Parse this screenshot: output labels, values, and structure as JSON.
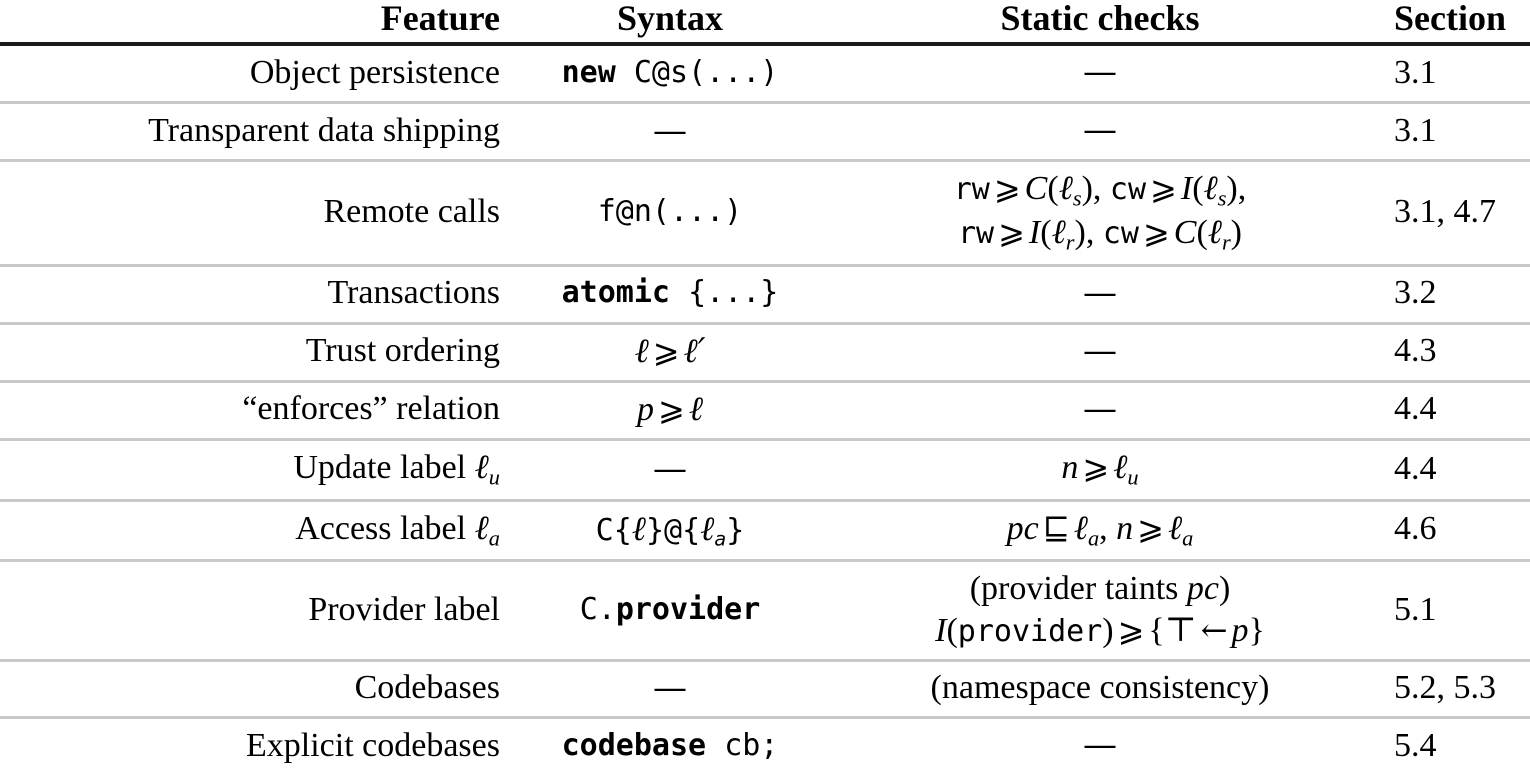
{
  "table": {
    "headers": {
      "feature": "Feature",
      "syntax": "Syntax",
      "checks": "Static checks",
      "section": "Section"
    },
    "rows": [
      {
        "feature": "Object persistence",
        "syntax": "new C@s(...)",
        "checks": "—",
        "section": "3.1"
      },
      {
        "feature": "Transparent data shipping",
        "syntax": "—",
        "checks": "—",
        "section": "3.1"
      },
      {
        "feature": "Remote calls",
        "syntax": "f@n(...)",
        "checks": "rw ⩾ C(ℓs), cw ⩾ I(ℓs), rw ⩾ I(ℓr), cw ⩾ C(ℓr)",
        "checks_line1": "rw ⩾ C(ℓs), cw ⩾ I(ℓs),",
        "checks_line2": "rw ⩾ I(ℓr), cw ⩾ C(ℓr)",
        "section": "3.1, 4.7"
      },
      {
        "feature": "Transactions",
        "syntax": "atomic {...}",
        "checks": "—",
        "section": "3.2"
      },
      {
        "feature": "Trust ordering",
        "syntax": "ℓ ⩾ ℓ′",
        "checks": "—",
        "section": "4.3"
      },
      {
        "feature": "“enforces” relation",
        "syntax": "p ⩾ ℓ",
        "checks": "—",
        "section": "4.4"
      },
      {
        "feature": "Update label ℓu",
        "syntax": "—",
        "checks": "n ⩾ ℓu",
        "section": "4.4"
      },
      {
        "feature": "Access label ℓa",
        "syntax": "C{ℓ}@{ℓa}",
        "checks": "pc ⊑ ℓa, n ⩾ ℓa",
        "section": "4.6"
      },
      {
        "feature": "Provider label",
        "syntax": "C.provider",
        "checks": "(provider taints pc) I(provider) ⩾ {⊤ ← p}",
        "checks_line1": "(provider taints pc)",
        "checks_line2": "I(provider) ⩾ {⊤ ← p}",
        "section": "5.1"
      },
      {
        "feature": "Codebases",
        "syntax": "—",
        "checks": "(namespace consistency)",
        "section": "5.2, 5.3"
      },
      {
        "feature": "Explicit codebases",
        "syntax": "codebase cb;",
        "checks": "—",
        "section": "5.4"
      }
    ]
  },
  "glyphs": {
    "em_dash": "—",
    "succeq_curly": "⩾",
    "sqsubseteq": "⊑",
    "top": "⊤",
    "left_arrow": "←",
    "ell": "ℓ",
    "ellipsis": "...",
    "prime": "′"
  },
  "colors": {
    "text": "#000000",
    "header_rule": "#1a1a1a",
    "row_rule": "#c9c9c9",
    "background": "#ffffff"
  }
}
